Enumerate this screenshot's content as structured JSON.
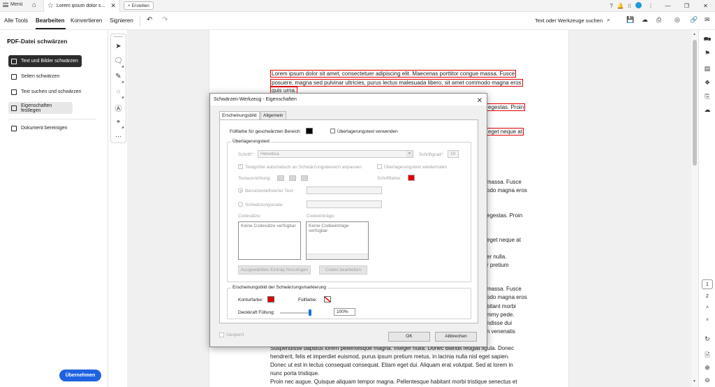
{
  "tabbar": {
    "menu_label": "Menü",
    "doc_tab_title": "Lorem ipsum dolor s...",
    "new_button": "+ Erstellen"
  },
  "menubar": {
    "items": [
      "Alle Tools",
      "Bearbeiten",
      "Konvertieren",
      "Signieren"
    ],
    "active": "Bearbeiten",
    "search_tools": "Text oder Werkzeuge suchen"
  },
  "leftpanel": {
    "title": "PDF-Datei schwärzen",
    "items": [
      "Text und Bilder schwärzen",
      "Seiten schwärzen",
      "Text suchen und schwärzen",
      "Eigenschaften festlegen",
      "Dokument bereinigen"
    ],
    "selected": "Text und Bilder schwärzen",
    "apply_button": "Übernehmen"
  },
  "document": {
    "redacted_lines": [
      "Lorem ipsum dolor sit amet, consectetuer adipiscing elit. Maecenas porttitor congue massa. Fusce",
      "posuere, magna sed pulvinar ultricies, purus lectus malesuada libero, sit amet commodo magna eros",
      "quis urna."
    ],
    "redacted_fragments": [
      "egestas. Proin",
      "eget neque at"
    ],
    "right_fragments": [
      "massa. Fusce",
      "odo magna eros",
      "egestas. Proin",
      "eget neque at",
      "er nulla.",
      "r pretium",
      "massa. Fusce",
      "odo magna eros",
      "bitant morbi",
      "mmy pede.",
      "ndisse dui",
      "n venenatis"
    ],
    "bottom_lines": [
      "Suspendisse dapibus lorem pellentesque magna. Integer nulla. Donec blandit feugiat ligula. Donec",
      "hendrerit, felis et imperdiet euismod, purus ipsum pretium metus, in lacinia nulla nisl eget sapien.",
      "Donec ut est in lectus consequat consequat. Etiam eget dui. Aliquam erat volutpat. Sed at lorem in",
      "nunc porta tristique.",
      "Proin nec augue. Quisque aliquam tempor magna. Pellentesque habitant morbi tristique senectus et"
    ]
  },
  "pages": {
    "current": "1",
    "next": "2"
  },
  "dialog": {
    "title": "Schwärzen-Werkzeug - Eigenschaften",
    "tabs": [
      "Erscheinungsbild",
      "Allgemein"
    ],
    "fill_label": "Füllfarbe für geschwärzten Bereich:",
    "fill_color": "#000000",
    "use_overlay_label": "Überlagerungstext verwenden",
    "overlay_group": "Überlagerungstext",
    "font_label": "Schrift*:",
    "font_value": "Helvetica",
    "size_label": "Schriftgrad*:",
    "size_value": "10",
    "autosize_label": "Textgröße automatisch an Schwärzungsbereich anpassen",
    "repeat_label": "Überlagerungstext wiederholen",
    "align_label": "Textausrichtung:",
    "fontcolor_label": "Schriftfarbe:",
    "font_color": "#e00000",
    "custom_text_label": "Benutzerdefinierter Text:",
    "code_label": "Schwärzungscode:",
    "codesets_label": "Codesätze:",
    "codeentries_label": "Codeeinträge:",
    "no_codesets": "Keine Codesätze verfügbar",
    "no_codeentries": "Keine Codeeinträge verfügbar",
    "add_entry_button": "Ausgewählten Eintrag hinzufügen",
    "edit_codes_button": "Codes bearbeiten",
    "appearance_group": "Erscheinungsbild der Schwärzungsmarkierung",
    "outline_label": "Konturfarbe:",
    "outline_color": "#e00000",
    "fillcolor_label": "Füllfarbe:",
    "opacity_label": "Deckkraft Füllung:",
    "opacity_value": "100%",
    "opacity_fraction": 1.0,
    "locked_label": "Gesperrt",
    "ok_button": "OK",
    "cancel_button": "Abbrechen"
  }
}
